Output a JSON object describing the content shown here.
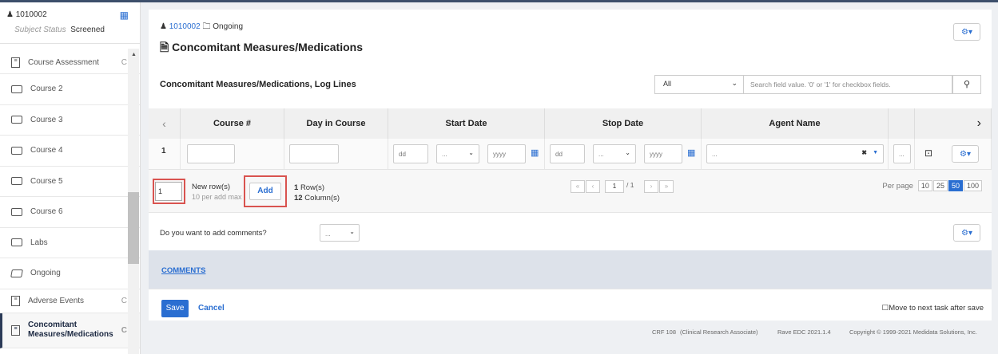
{
  "sidebar": {
    "subject_id": "1010002",
    "subject_status_label": "Subject Status",
    "subject_status_value": "Screened",
    "items": [
      {
        "label": "Course Assessment",
        "type": "doc",
        "right": "C"
      },
      {
        "label": "Course 2",
        "type": "folder"
      },
      {
        "label": "Course 3",
        "type": "folder"
      },
      {
        "label": "Course 4",
        "type": "folder"
      },
      {
        "label": "Course 5",
        "type": "folder"
      },
      {
        "label": "Course 6",
        "type": "folder"
      },
      {
        "label": "Labs",
        "type": "folder"
      },
      {
        "label": "Ongoing",
        "type": "folder-open"
      },
      {
        "label": "Adverse Events",
        "type": "doc",
        "right": "C"
      },
      {
        "label": "Concomitant Measures/Medications",
        "type": "doc",
        "right": "C",
        "active": true
      }
    ]
  },
  "header": {
    "subject_id": "1010002",
    "folder": "Ongoing",
    "title": "Concomitant Measures/Medications"
  },
  "loglines": {
    "title": "Concomitant Measures/Medications, Log Lines",
    "filter_value": "All",
    "search_placeholder": "Search field value. '0' or '1' for checkbox fields."
  },
  "table": {
    "columns": [
      "Course #",
      "Day in Course",
      "Start Date",
      "Stop Date",
      "Agent Name"
    ],
    "row_number": "1",
    "date_dd": "dd",
    "date_month": "...",
    "date_yyyy": "yyyy",
    "agent_placeholder": "...",
    "extra_placeholder": "..."
  },
  "footer": {
    "new_rows_value": "1",
    "new_rows_label": "New row(s)",
    "per_add_max": "10 per add max",
    "add_label": "Add",
    "row_count": "1",
    "row_suffix": "Row(s)",
    "column_count": "12",
    "column_suffix": "Column(s)",
    "page_current": "1",
    "page_total": "/ 1",
    "per_page_label": "Per page",
    "per_page_options": [
      "10",
      "25",
      "50",
      "100"
    ]
  },
  "comments_question": "Do you want to add comments?",
  "comments_select": "...",
  "comments_link": "COMMENTS",
  "save_label": "Save",
  "cancel_label": "Cancel",
  "move_next_label": "Move to next task after save",
  "bottom": {
    "crf": "CRF 108",
    "role": "(Clinical Research Associate)",
    "version": "Rave EDC 2021.1.4",
    "copyright": "Copyright © 1999-2021 Medidata Solutions, Inc."
  },
  "colors": {
    "accent": "#2a6ed1",
    "nav_dark": "#2b3a57",
    "highlight": "#d9534f"
  }
}
